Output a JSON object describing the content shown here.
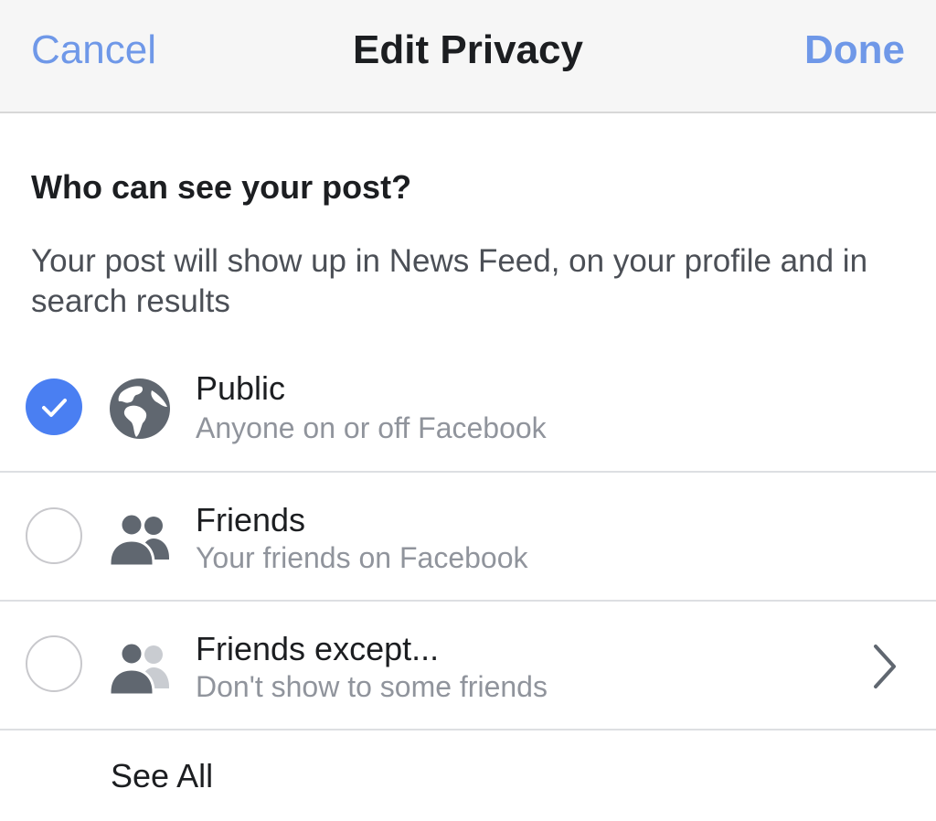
{
  "navbar": {
    "cancel_label": "Cancel",
    "title": "Edit Privacy",
    "done_label": "Done"
  },
  "heading": "Who can see your post?",
  "description": "Your post will show up in News Feed, on your profile and in search results",
  "options": [
    {
      "label": "Public",
      "sublabel": "Anyone on or off Facebook",
      "icon": "globe-icon",
      "selected": true
    },
    {
      "label": "Friends",
      "sublabel": "Your friends on Facebook",
      "icon": "friends-icon",
      "selected": false
    },
    {
      "label": "Friends except...",
      "sublabel": "Don't show to some friends",
      "icon": "friends-except-icon",
      "selected": false,
      "has_chevron": true
    }
  ],
  "see_all_label": "See All",
  "colors": {
    "accent": "#4a7ff2",
    "nav_link": "#6f98e8",
    "icon_gray": "#606770",
    "text_primary": "#1c1e21",
    "text_secondary": "#90949c"
  }
}
